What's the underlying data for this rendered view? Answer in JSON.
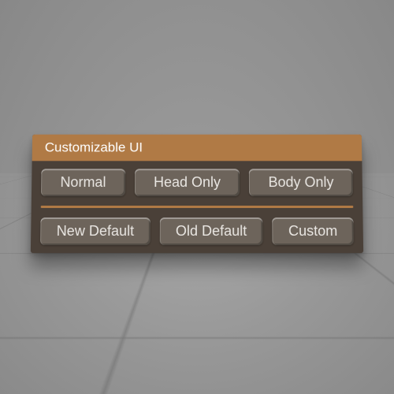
{
  "panel": {
    "title": "Customizable UI",
    "row1": [
      {
        "label": "Normal"
      },
      {
        "label": "Head Only"
      },
      {
        "label": "Body Only"
      }
    ],
    "row2": [
      {
        "label": "New Default"
      },
      {
        "label": "Old Default"
      },
      {
        "label": "Custom"
      }
    ],
    "colors": {
      "accent": "#b07a45",
      "panel_bg": "#4a4038",
      "button_bg": "#6d645b"
    }
  }
}
